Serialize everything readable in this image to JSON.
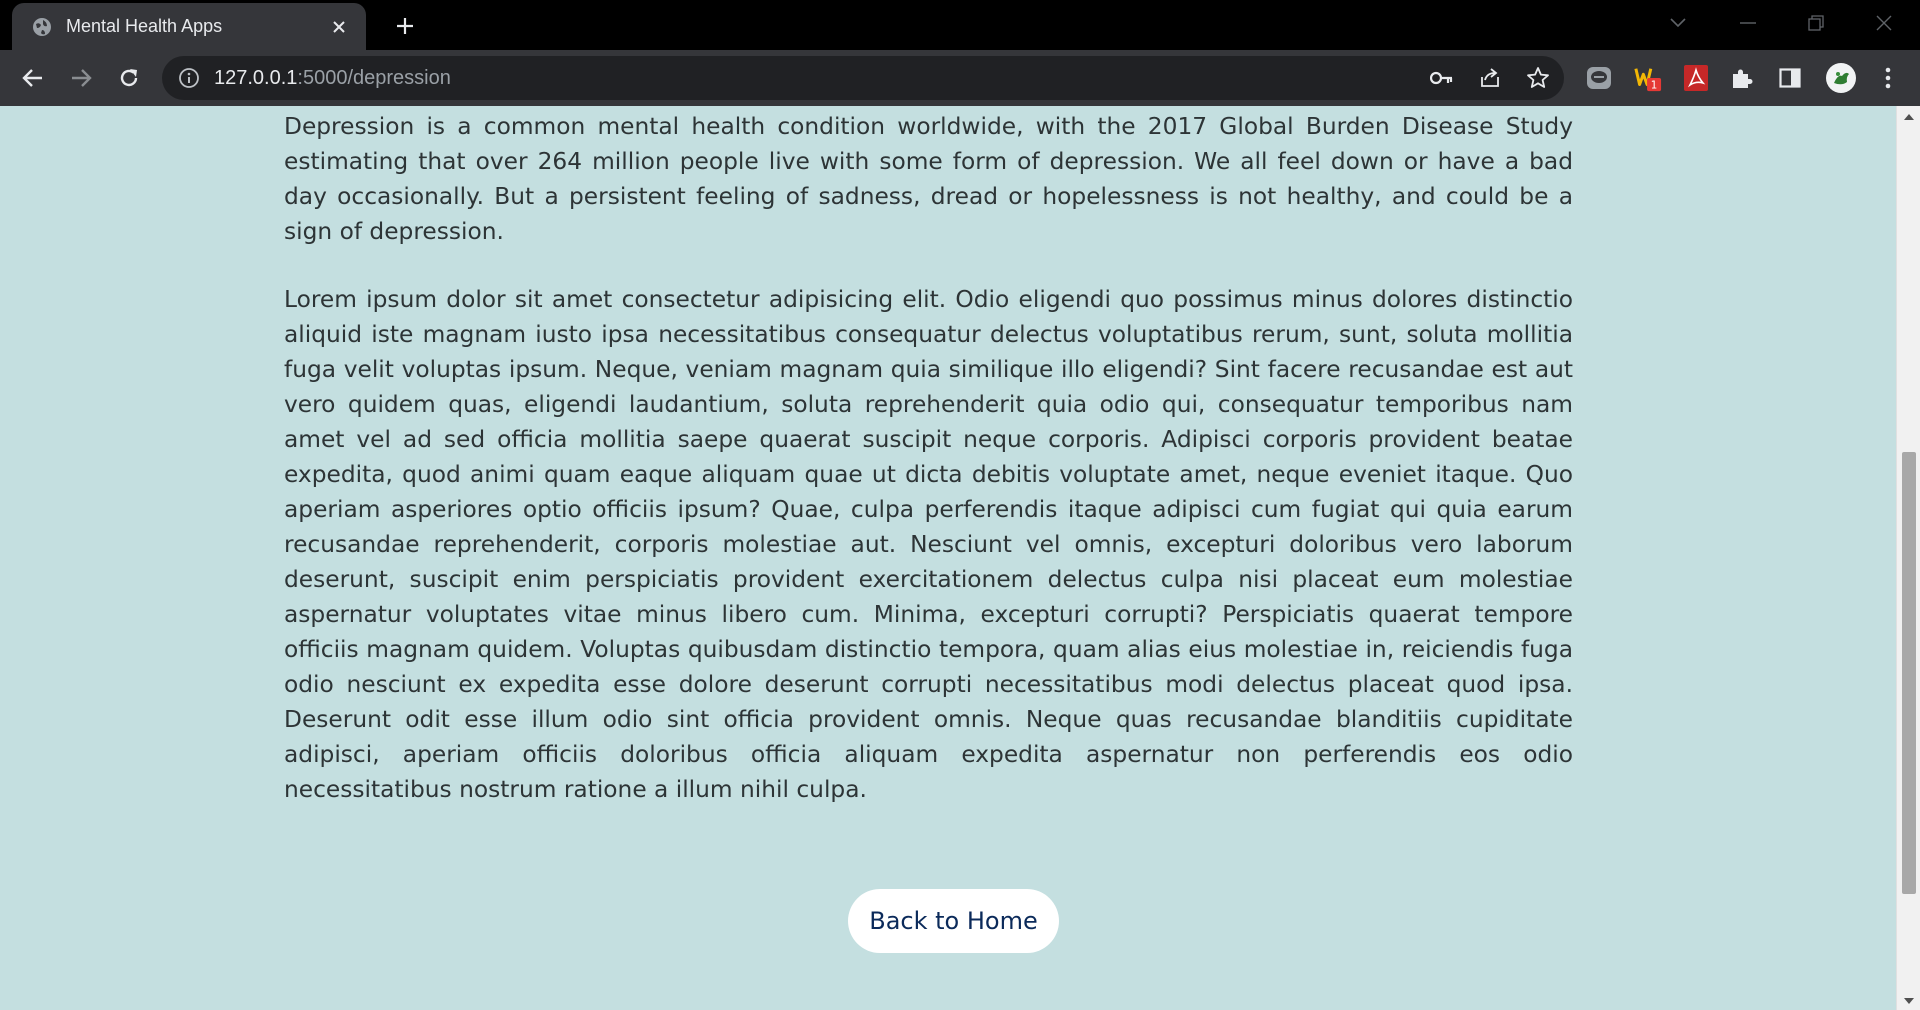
{
  "browser": {
    "tab_title": "Mental Health Apps",
    "url_host": "127.0.0.1",
    "url_path": ":5000/depression",
    "extension_badge": "1"
  },
  "page": {
    "intro": "Depression is a common mental health condition worldwide, with the 2017 Global Burden Disease Study estimating that over 264 million people live with some form of depression. We all feel down or have a bad day occasionally. But a persistent feeling of sadness, dread or hopelessness is not healthy, and could be a sign of depression.",
    "body": "Lorem ipsum dolor sit amet consectetur adipisicing elit. Odio eligendi quo possimus minus dolores distinctio aliquid iste magnam iusto ipsa necessitatibus consequatur delectus voluptatibus rerum, sunt, soluta mollitia fuga velit voluptas ipsum. Neque, veniam magnam quia similique illo eligendi? Sint facere recusandae est aut vero quidem quas, eligendi laudantium, soluta reprehenderit quia odio qui, consequatur temporibus nam amet vel ad sed officia mollitia saepe quaerat suscipit neque corporis. Adipisci corporis provident beatae expedita, quod animi quam eaque aliquam quae ut dicta debitis voluptate amet, neque eveniet itaque. Quo aperiam asperiores optio officiis ipsum? Quae, culpa perferendis itaque adipisci cum fugiat qui quia earum recusandae reprehenderit, corporis molestiae aut. Nesciunt vel omnis, excepturi doloribus vero laborum deserunt, suscipit enim perspiciatis provident exercitationem delectus culpa nisi placeat eum molestiae aspernatur voluptates vitae minus libero cum. Minima, excepturi corrupti? Perspiciatis quaerat tempore officiis magnam quidem. Voluptas quibusdam distinctio tempora, quam alias eius molestiae in, reiciendis fuga odio nesciunt ex expedita esse dolore deserunt corrupti necessitatibus modi delectus placeat quod ipsa. Deserunt odit esse illum odio sint officia provident omnis. Neque quas recusandae blanditiis cupiditate adipisci, aperiam officiis doloribus officia aliquam expedita aspernatur non perferendis eos odio necessitatibus nostrum ratione a illum nihil culpa.",
    "back_button_label": "Back to Home"
  },
  "colors": {
    "page_background": "#c4dfe0",
    "text": "#2d3436",
    "button_text": "#0b2a5a"
  },
  "icons": {
    "tab": [
      "globe-icon",
      "close-icon",
      "plus-icon"
    ],
    "window": [
      "tab-search-icon",
      "minimize-icon",
      "restore-icon",
      "close-window-icon"
    ],
    "toolbar": [
      "back-arrow-icon",
      "forward-arrow-icon",
      "reload-icon",
      "info-icon",
      "key-icon",
      "share-icon",
      "star-icon",
      "line-extension-icon",
      "w-extension-icon",
      "pdf-extension-icon",
      "puzzle-icon",
      "side-panel-icon",
      "profile-avatar-icon",
      "more-vert-icon"
    ]
  }
}
